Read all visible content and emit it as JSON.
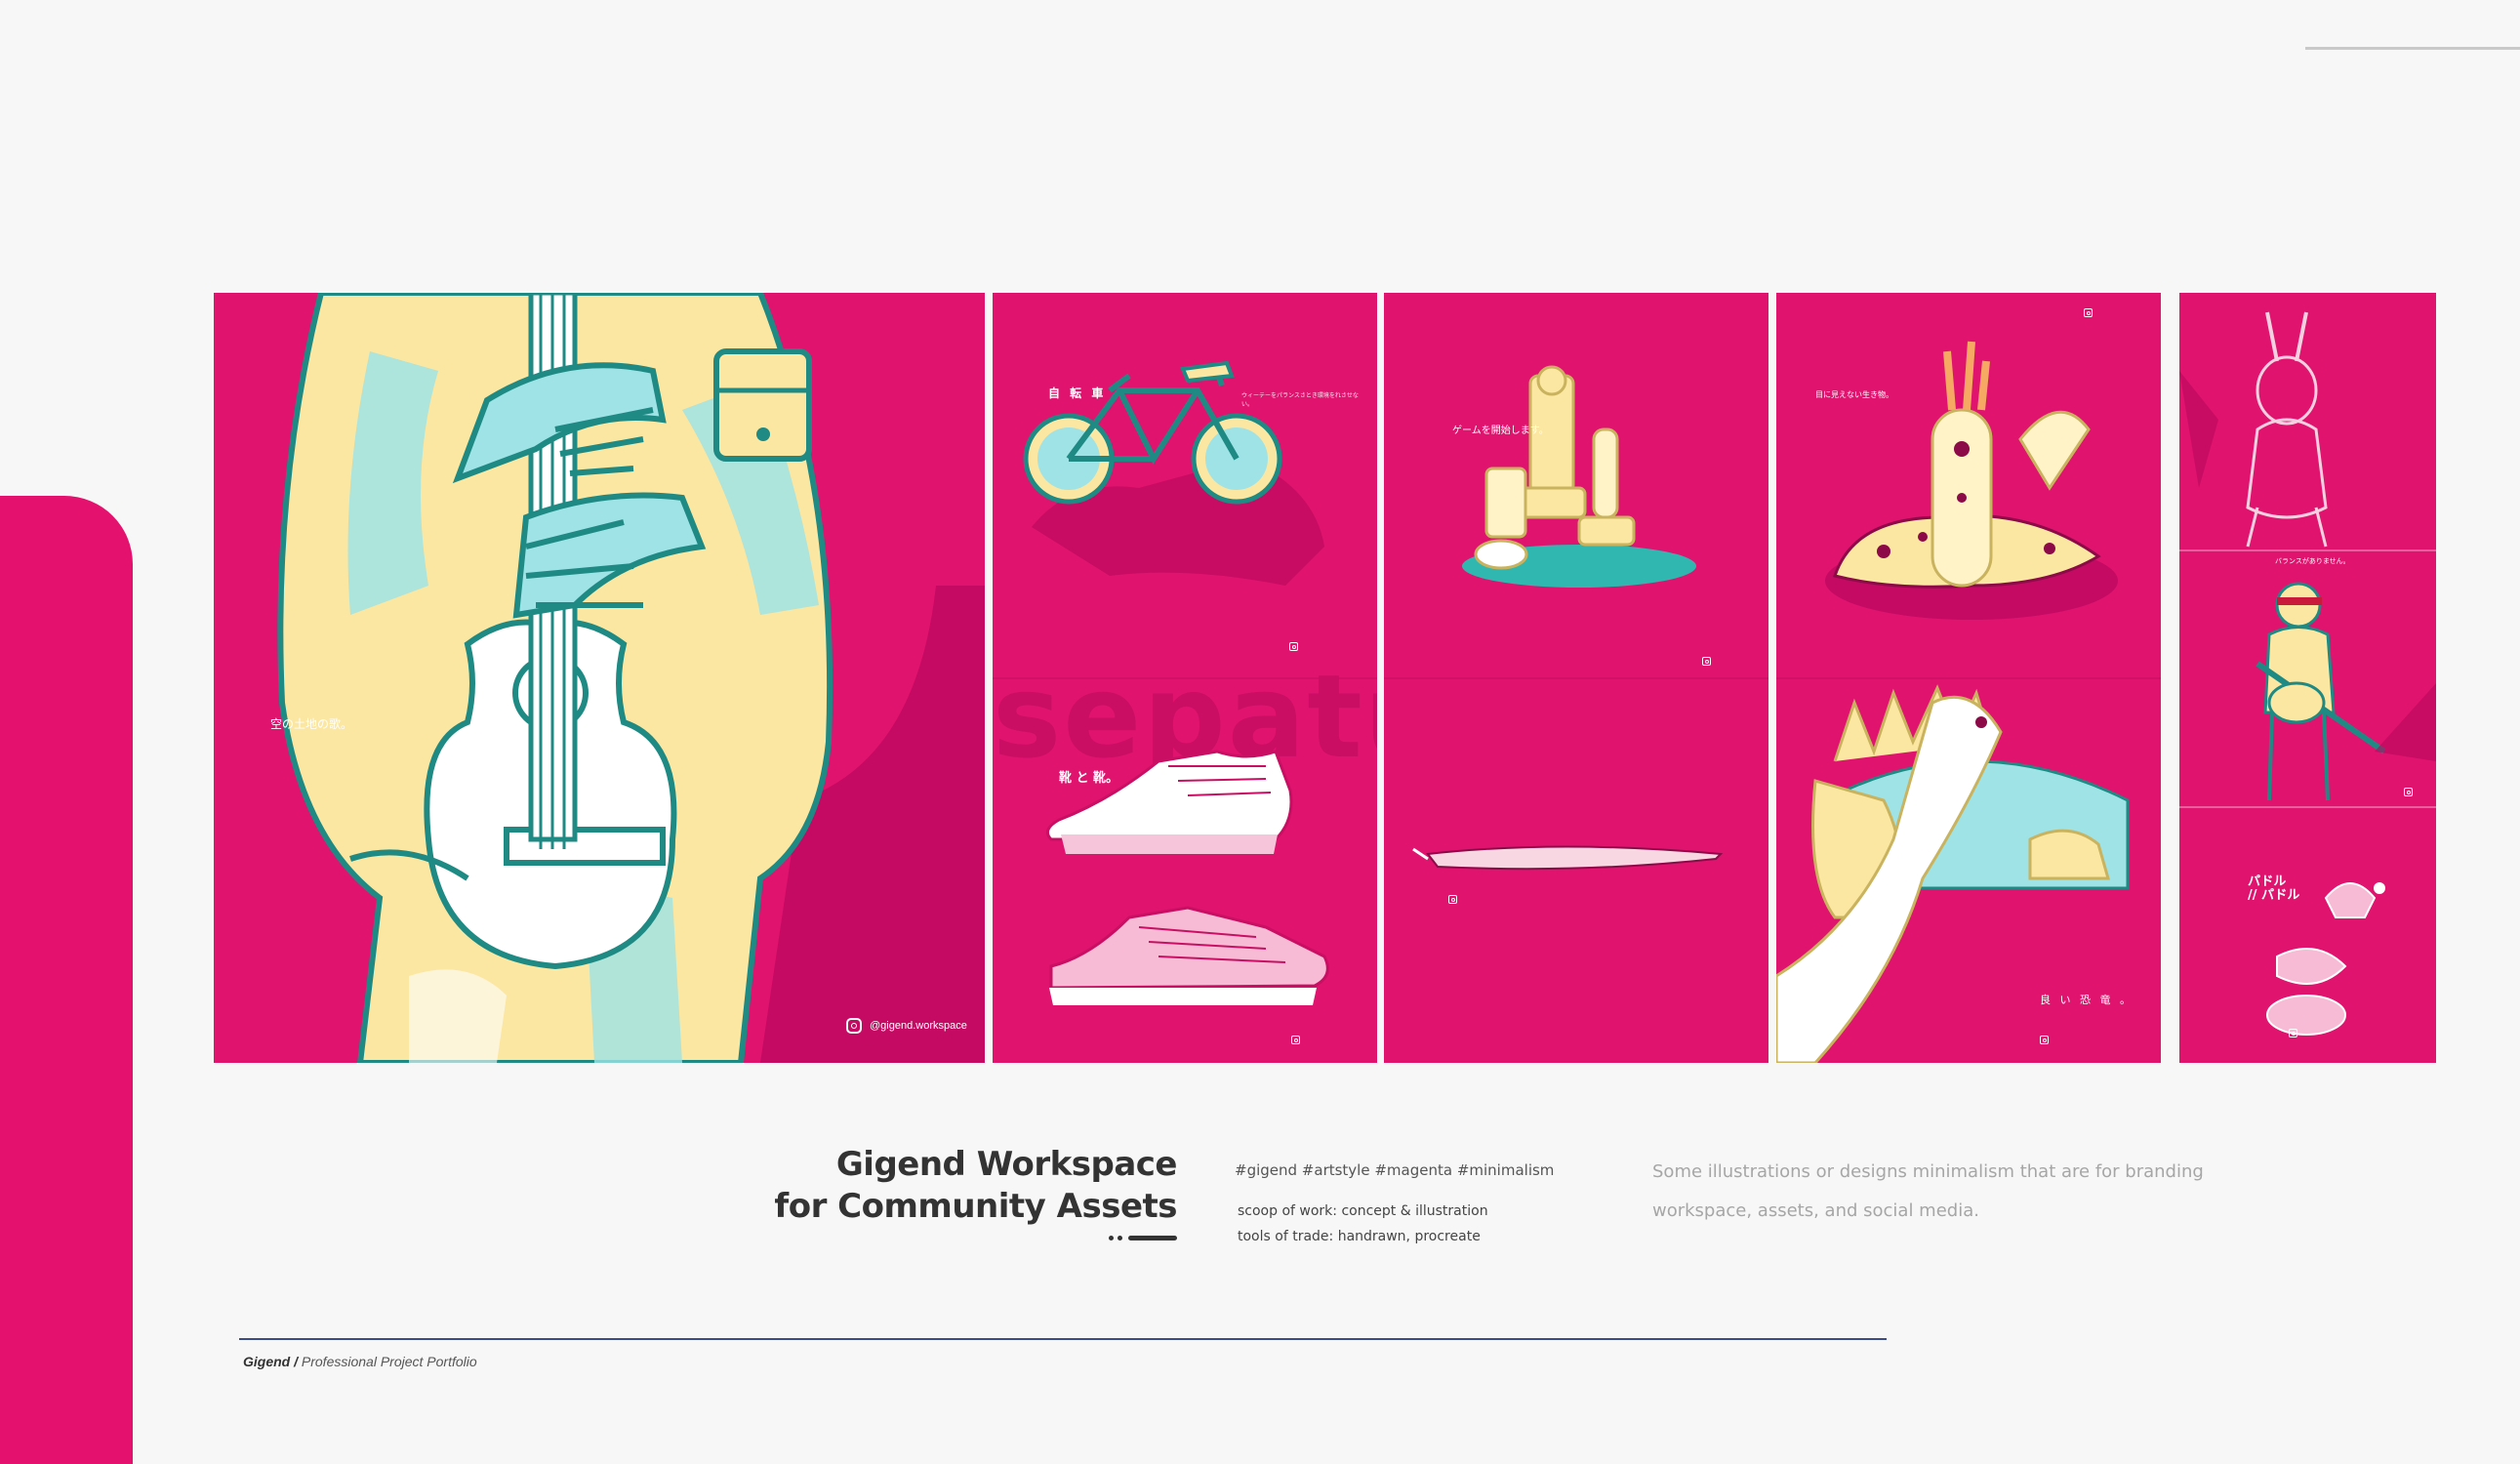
{
  "panels": {
    "p1": {
      "caption": "空の土地の歌。",
      "handle": "@gigend.workspace"
    },
    "p2": {
      "top_title": "自 転 車",
      "top_sub": "ウィーテーをパランスさとき環境をれさせない。",
      "ghost_word": "sepatu",
      "bottom_title": "靴 と 靴。"
    },
    "p3": {
      "top_title": "ゲームを開始します。"
    },
    "p4": {
      "top_title": "目に見えない生き物。",
      "bottom_title": "良 い 恐 竜 。"
    },
    "p5": {
      "mid_title": "バランスがありません。",
      "bottom_title_1": "パドル",
      "bottom_title_2": "// パドル"
    }
  },
  "project": {
    "title_line1": "Gigend Workspace",
    "title_line2": "for Community Assets",
    "tags": "#gigend #artstyle #magenta #minimalism",
    "scope": "scoop of work: concept & illustration",
    "tools": "tools of trade: handrawn, procreate",
    "description": "Some illustrations or designs minimalism that are for branding workspace, assets, and social media."
  },
  "footer": {
    "brand": "Gigend /",
    "subtitle": "Professional Project Portfolio"
  },
  "colors": {
    "magenta": "#e0136f",
    "teal": "#1f8a84",
    "yellow": "#fbe7a1",
    "cyan": "#9fe3e6",
    "footer_line": "#3c4c86"
  },
  "icons": [
    "instagram-icon"
  ]
}
